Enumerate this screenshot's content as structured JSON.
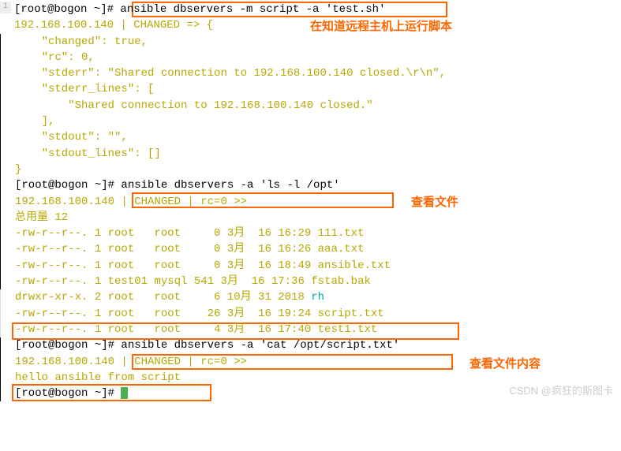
{
  "prompt": "[root@bogon ~]# ",
  "cmd1": "ansible dbservers -m script -a 'test.sh'",
  "label1": "在知道远程主机上运行脚本",
  "out1_l1": "192.168.100.140 | CHANGED => {",
  "out1_l2": "    \"changed\": true,",
  "out1_l3": "    \"rc\": 0,",
  "out1_l4": "    \"stderr\": \"Shared connection to 192.168.100.140 closed.\\r\\n\",",
  "out1_l5": "    \"stderr_lines\": [",
  "out1_l6": "        \"Shared connection to 192.168.100.140 closed.\"",
  "out1_l7": "    ],",
  "out1_l8": "    \"stdout\": \"\",",
  "out1_l9": "    \"stdout_lines\": []",
  "out1_l10": "}",
  "cmd2": "ansible dbservers -a 'ls -l /opt'",
  "label2": "查看文件",
  "out2_l1": "192.168.100.140 | CHANGED | rc=0 >>",
  "out2_l2": "总用量 12",
  "out2_l3": "-rw-r--r--. 1 root   root     0 3月  16 16:29 111.txt",
  "out2_l4": "-rw-r--r--. 1 root   root     0 3月  16 16:26 aaa.txt",
  "out2_l5": "-rw-r--r--. 1 root   root     0 3月  16 18:49 ansible.txt",
  "out2_l6": "-rw-r--r--. 1 test01 mysql 541 3月  16 17:36 fstab.bak",
  "out2_l7a": "drwxr-xr-x. 2 root   root     6 10月 31 2018 ",
  "out2_l7b": "rh",
  "out2_l8": "-rw-r--r--. 1 root   root    26 3月  16 19:24 script.txt",
  "out2_l9": "-rw-r--r--. 1 root   root     4 3月  16 17:40 test1.txt",
  "cmd3": "ansible dbservers -a 'cat /opt/script.txt'",
  "label3": "查看文件内容",
  "out3_l1": "192.168.100.140 | CHANGED | rc=0 >>",
  "out3_l2": "hello ansible from script",
  "gutter1": "1",
  "watermark": "CSDN @疯狂的斯图卡"
}
